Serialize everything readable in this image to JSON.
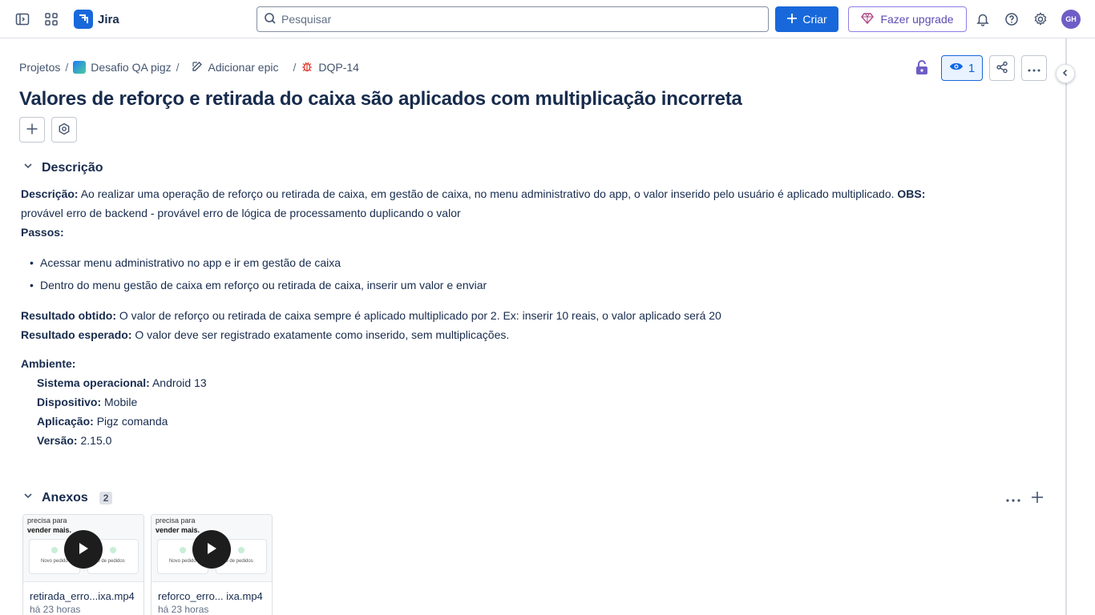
{
  "topbar": {
    "app_name": "Jira",
    "search_placeholder": "Pesquisar",
    "create_label": "Criar",
    "upgrade_label": "Fazer upgrade",
    "avatar_initials": "GH"
  },
  "breadcrumb": {
    "projects": "Projetos",
    "project_name": "Desafio QA pigz",
    "add_epic": "Adicionar epic",
    "issue_key": "DQP-14"
  },
  "header": {
    "watchers_count": "1"
  },
  "issue": {
    "title": "Valores de reforço e retirada do caixa são aplicados com multiplicação incorreta"
  },
  "description": {
    "section_title": "Descrição",
    "desc_label": "Descrição:",
    "desc_text": " Ao realizar uma operação de reforço ou retirada de caixa, em gestão de caixa, no menu administrativo do app, o valor inserido pelo usuário é aplicado multiplicado. ",
    "obs_label": "OBS:",
    "obs_text": "provável erro de backend - provável erro de lógica de processamento duplicando o valor",
    "steps_label": "Passos:",
    "steps": [
      "Acessar menu administrativo no app e ir em gestão de caixa",
      "Dentro do menu gestão de caixa em reforço ou retirada de caixa, inserir um valor e enviar"
    ],
    "obtained_label": "Resultado obtido:",
    "obtained_text": " O valor de reforço ou retirada de caixa sempre é aplicado multiplicado por 2. Ex: inserir 10 reais, o valor aplicado será 20",
    "expected_label": "Resultado esperado:",
    "expected_text": " O valor deve ser registrado exatamente como inserido, sem multiplicações.",
    "env_label": "Ambiente:",
    "os_label": "Sistema operacional:",
    "os_value": " Android 13",
    "device_label": "Dispositivo:",
    "device_value": " Mobile",
    "app_label": "Aplicação:",
    "app_value": " Pigz comanda",
    "version_label": "Versão:",
    "version_value": " 2.15.0"
  },
  "attachments": {
    "section_title": "Anexos",
    "count": "2",
    "items": [
      {
        "name": "retirada_erro...ixa.mp4",
        "time": "há 23 horas",
        "thumb_line1": "precisa para",
        "thumb_line2": "vender mais.",
        "thumb_label1": "Novo pedido",
        "thumb_label2": "rico de pedidos"
      },
      {
        "name": "reforco_erro... ixa.mp4",
        "time": "há 23 horas",
        "thumb_line1": "precisa para",
        "thumb_line2": "vender mais.",
        "thumb_label1": "Novo pedido",
        "thumb_label2": "rico de pedidos"
      }
    ]
  },
  "colors": {
    "brand_blue": "#1868db",
    "upgrade_purple": "#5e4db2",
    "lock_purple": "#6e5dc6",
    "bug_red": "#e2483d"
  },
  "icons": {
    "sidebar_toggle": "sidebar-toggle-icon",
    "app_switcher": "app-switcher-icon",
    "search": "search-icon",
    "plus": "plus-icon",
    "gem": "gem-icon",
    "bell": "bell-icon",
    "help": "help-icon",
    "settings": "gear-icon",
    "edit": "pencil-icon",
    "bug": "bug-icon",
    "lock": "unlock-icon",
    "eye": "eye-icon",
    "share": "share-icon",
    "more": "more-icon",
    "chevron_left": "chevron-left-icon",
    "chevron_down": "chevron-down-icon",
    "play": "play-icon"
  }
}
